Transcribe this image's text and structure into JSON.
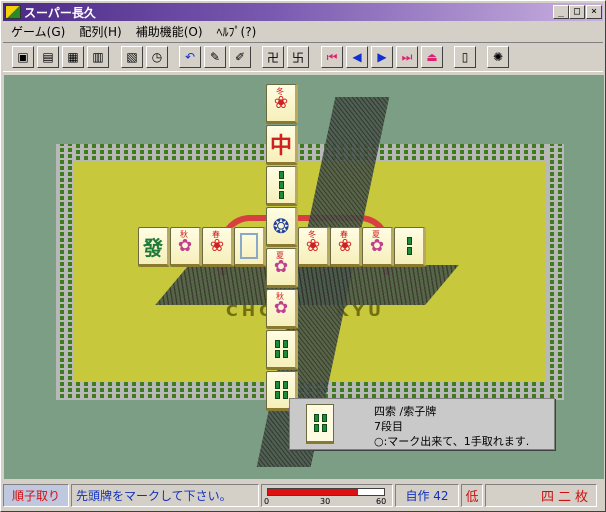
{
  "window": {
    "title": "スーパー長久",
    "controls": [
      "_",
      "□",
      "×"
    ]
  },
  "menu": [
    {
      "label": "ゲーム(G)"
    },
    {
      "label": "配列(H)"
    },
    {
      "label": "補助機能(O)"
    },
    {
      "label": "ﾍﾙﾌﾟ(?)"
    }
  ],
  "toolbar": {
    "buttons": [
      {
        "icon": "card-icon",
        "glyph": "▣"
      },
      {
        "icon": "list-icon",
        "glyph": "▤"
      },
      {
        "icon": "tiles-icon",
        "glyph": "▦"
      },
      {
        "icon": "tiles-gray-icon",
        "glyph": "▥"
      },
      {
        "icon": "note-icon",
        "glyph": "▧"
      },
      {
        "icon": "clock-icon",
        "glyph": "◷"
      },
      {
        "icon": "undo-icon",
        "glyph": "↶"
      },
      {
        "icon": "hint-icon",
        "glyph": "✎"
      },
      {
        "icon": "wand-icon",
        "glyph": "✐"
      },
      {
        "icon": "arrange-icon",
        "glyph": "卍"
      },
      {
        "icon": "arrange-alt-icon",
        "glyph": "卐"
      },
      {
        "icon": "first-icon",
        "glyph": "⏮"
      },
      {
        "icon": "prev-icon",
        "glyph": "◀"
      },
      {
        "icon": "next-icon",
        "glyph": "▶"
      },
      {
        "icon": "last-icon",
        "glyph": "⏭"
      },
      {
        "icon": "eject-icon",
        "glyph": "⏏"
      },
      {
        "icon": "trash-icon",
        "glyph": "▯"
      },
      {
        "icon": "bulb-icon",
        "glyph": "✺"
      }
    ]
  },
  "board": {
    "watermark_left": "CHO",
    "watermark_right": "KYU",
    "tiles_vertical": [
      {
        "label": "冬",
        "kind": "flower"
      },
      {
        "label": "中",
        "kind": "dragon"
      },
      {
        "label": "",
        "kind": "bamboo"
      },
      {
        "label": "",
        "kind": "bird"
      },
      {
        "label": "夏",
        "kind": "flower"
      },
      {
        "label": "秋",
        "kind": "flower"
      },
      {
        "label": "",
        "kind": "bamboo"
      },
      {
        "label": "",
        "kind": "bamboo"
      }
    ],
    "tiles_horizontal": [
      {
        "label": "發",
        "kind": "dragon-green"
      },
      {
        "label": "秋",
        "kind": "flower"
      },
      {
        "label": "春",
        "kind": "flower"
      },
      {
        "label": "",
        "kind": "white"
      },
      {
        "label": "冬",
        "kind": "flower"
      },
      {
        "label": "春",
        "kind": "flower"
      },
      {
        "label": "夏",
        "kind": "flower"
      },
      {
        "label": "",
        "kind": "bamboo"
      }
    ]
  },
  "tooltip": {
    "name": "四索 /索子牌",
    "level": "7段目",
    "note": "○:マーク出来て、1手取れます."
  },
  "status": {
    "mode": "順子取り",
    "message": "先頭牌をマークして下さい。",
    "gauge": {
      "fraction": 0.78,
      "ticks": [
        "0",
        "30",
        "60"
      ]
    },
    "count": "自作 42",
    "level": "低",
    "remaining": "四二枚"
  }
}
